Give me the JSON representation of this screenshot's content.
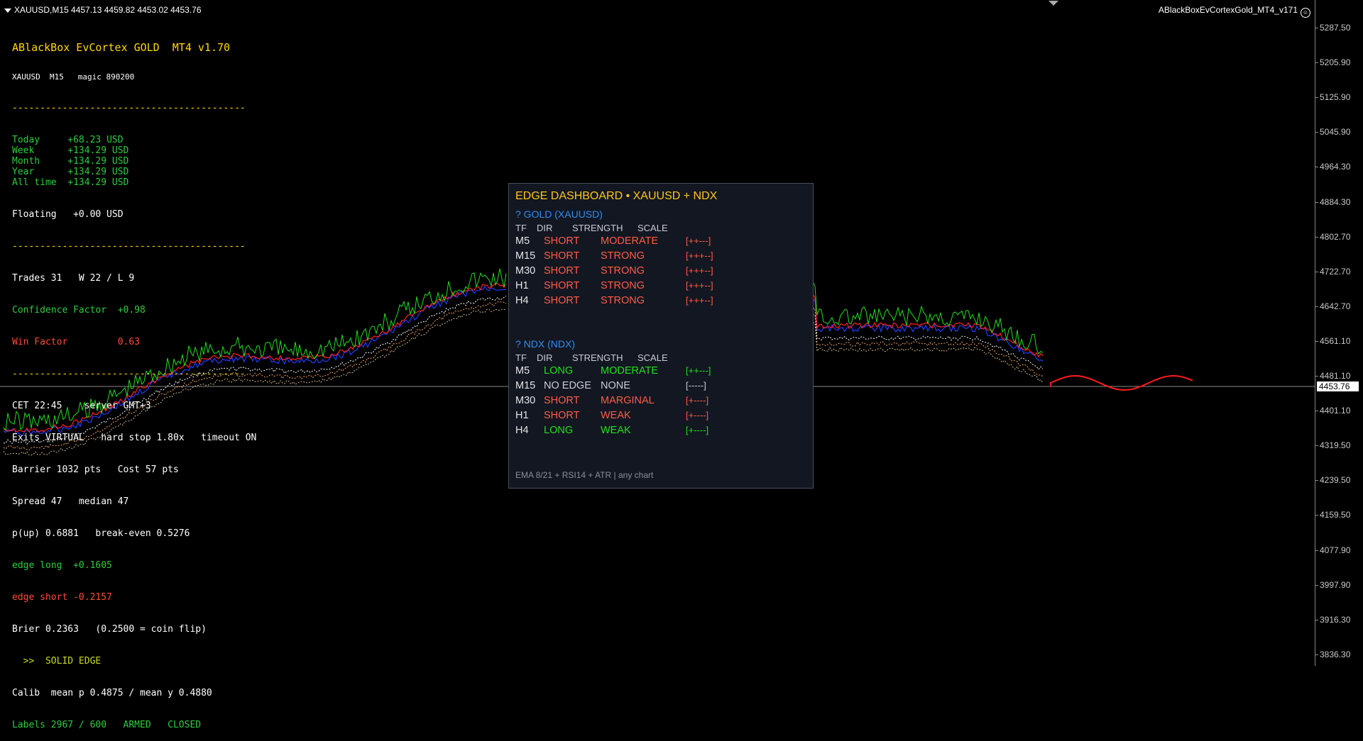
{
  "header": {
    "symbol_line": "XAUUSD,M15  4457.13 4459.82 4453.02 4453.76",
    "ea_name": "ABlackBoxEvCortexGold_MT4_v171"
  },
  "price_axis": {
    "ticks": [
      "5287.50",
      "5205.90",
      "5125.90",
      "5045.90",
      "4964.30",
      "4884.30",
      "4802.70",
      "4722.70",
      "4642.70",
      "4561.10",
      "4481.10",
      "4401.10",
      "4319.50",
      "4239.50",
      "4159.50",
      "4077.90",
      "3997.90",
      "3916.30",
      "3836.30"
    ],
    "current_price": "4453.76"
  },
  "info": {
    "title": "ABlackBox EvCortex GOLD  MT4 v1.70",
    "subtitle": "XAUUSD  M15   magic 890200",
    "separator": "------------------------------------------",
    "pnl": [
      {
        "label": "Today     ",
        "value": "+68.23 USD"
      },
      {
        "label": "Week      ",
        "value": "+134.29 USD"
      },
      {
        "label": "Month     ",
        "value": "+134.29 USD"
      },
      {
        "label": "Year      ",
        "value": "+134.29 USD"
      },
      {
        "label": "All time  ",
        "value": "+134.29 USD"
      }
    ],
    "floating": "Floating   +0.00 USD",
    "trades": "Trades 31   W 22 / L 9",
    "confidence": "Confidence Factor  +0.98",
    "win_factor": "Win Factor         0.63",
    "time": "CET 22:45    server GMT+3",
    "exits": "Exits VIRTUAL   hard stop 1.80x   timeout ON",
    "barrier": "Barrier 1032 pts   Cost 57 pts",
    "spread": "Spread 47   median 47",
    "pup": "p(up) 0.6881   break-even 0.5276",
    "edge_long": "edge long  +0.1605",
    "edge_short": "edge short -0.2157",
    "brier": "Brier 0.2363   (0.2500 = coin flip)",
    "solid_edge": "  >>  SOLID EDGE",
    "calib": "Calib  mean p 0.4875 / mean y 0.4880",
    "labels": "Labels 2967 / 600   ARMED   CLOSED"
  },
  "dashboard": {
    "title": "EDGE DASHBOARD  •  XAUUSD + NDX",
    "columns": {
      "tf": "TF",
      "dir": "DIR",
      "strength": "STRENGTH",
      "scale": "SCALE"
    },
    "gold": {
      "title": "? GOLD  (XAUUSD)",
      "rows": [
        {
          "tf": "M5",
          "dir": "SHORT",
          "strength": "MODERATE",
          "scale": "[++---]",
          "cls": "short"
        },
        {
          "tf": "M15",
          "dir": "SHORT",
          "strength": "STRONG",
          "scale": "[+++--]",
          "cls": "short"
        },
        {
          "tf": "M30",
          "dir": "SHORT",
          "strength": "STRONG",
          "scale": "[+++--]",
          "cls": "short"
        },
        {
          "tf": "H1",
          "dir": "SHORT",
          "strength": "STRONG",
          "scale": "[+++--]",
          "cls": "short"
        },
        {
          "tf": "H4",
          "dir": "SHORT",
          "strength": "STRONG",
          "scale": "[+++--]",
          "cls": "short"
        }
      ]
    },
    "ndx": {
      "title": "? NDX  (NDX)",
      "rows": [
        {
          "tf": "M5",
          "dir": "LONG",
          "strength": "MODERATE",
          "scale": "[++---]",
          "cls": "long"
        },
        {
          "tf": "M15",
          "dir": "NO EDGE",
          "strength": "NONE",
          "scale": "[-----]",
          "cls": "none"
        },
        {
          "tf": "M30",
          "dir": "SHORT",
          "strength": "MARGINAL",
          "scale": "[+----]",
          "cls": "short"
        },
        {
          "tf": "H1",
          "dir": "SHORT",
          "strength": "WEAK",
          "scale": "[+----]",
          "cls": "short"
        },
        {
          "tf": "H4",
          "dir": "LONG",
          "strength": "WEAK",
          "scale": "[+----]",
          "cls": "long"
        }
      ]
    },
    "footer": "EMA 8/21 + RSI14 + ATR  |  any chart"
  }
}
